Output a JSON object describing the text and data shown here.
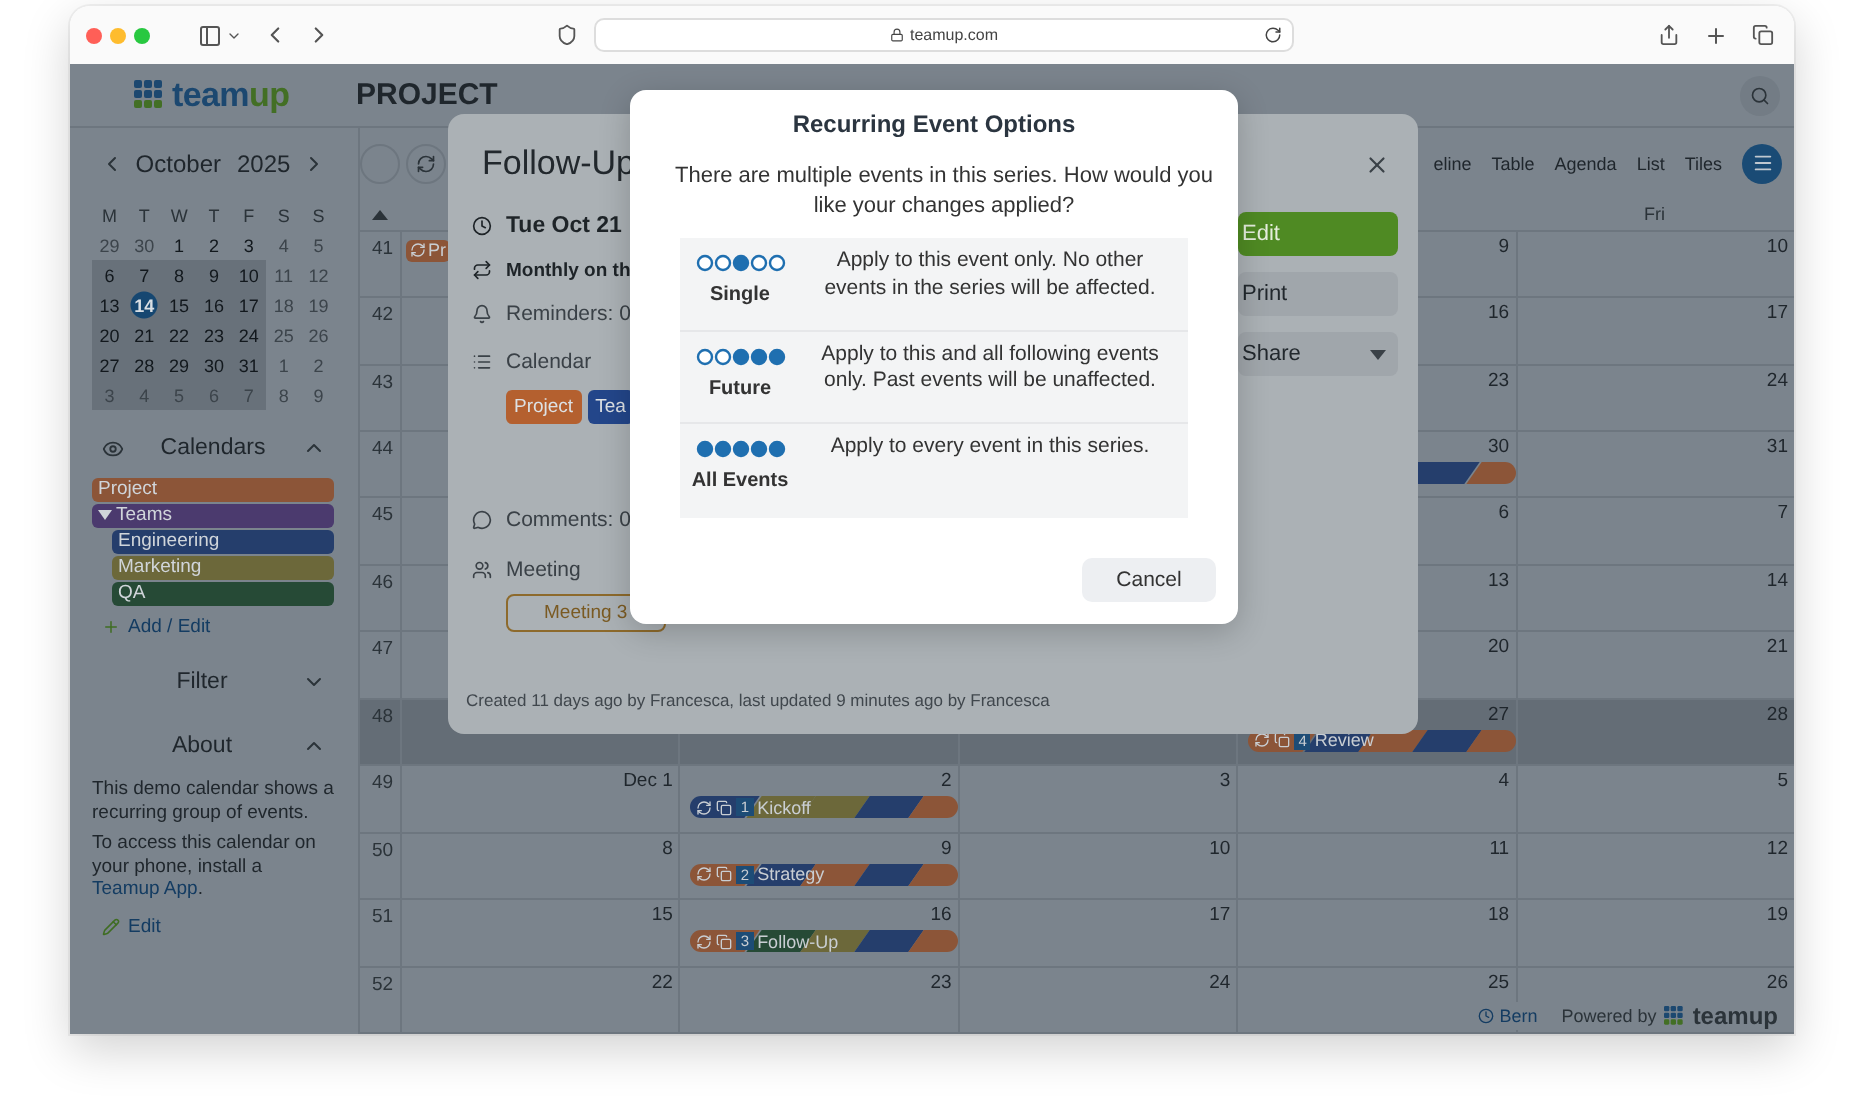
{
  "browser": {
    "address": "teamup.com"
  },
  "app_header": {
    "logo": [
      "team",
      "up"
    ],
    "title": "PROJECT"
  },
  "mini_calendar": {
    "month": "October",
    "year": "2025",
    "weekdays": [
      "M",
      "T",
      "W",
      "T",
      "F",
      "S",
      "S"
    ],
    "weeks": [
      {
        "in_view": false,
        "days": [
          {
            "label": "29",
            "muted": true,
            "today": false
          },
          {
            "label": "30",
            "muted": true,
            "today": false
          },
          {
            "label": "1",
            "muted": false,
            "today": false
          },
          {
            "label": "2",
            "muted": false,
            "today": false
          },
          {
            "label": "3",
            "muted": false,
            "today": false
          },
          {
            "label": "4",
            "muted": true,
            "today": false
          },
          {
            "label": "5",
            "muted": true,
            "today": false
          }
        ]
      },
      {
        "in_view": true,
        "days": [
          {
            "label": "6",
            "muted": false,
            "today": false
          },
          {
            "label": "7",
            "muted": false,
            "today": false
          },
          {
            "label": "8",
            "muted": false,
            "today": false
          },
          {
            "label": "9",
            "muted": false,
            "today": false
          },
          {
            "label": "10",
            "muted": false,
            "today": false
          },
          {
            "label": "11",
            "muted": true,
            "today": false
          },
          {
            "label": "12",
            "muted": true,
            "today": false
          }
        ]
      },
      {
        "in_view": true,
        "days": [
          {
            "label": "13",
            "muted": false,
            "today": false
          },
          {
            "label": "14",
            "muted": false,
            "today": true
          },
          {
            "label": "15",
            "muted": false,
            "today": false
          },
          {
            "label": "16",
            "muted": false,
            "today": false
          },
          {
            "label": "17",
            "muted": false,
            "today": false
          },
          {
            "label": "18",
            "muted": true,
            "today": false
          },
          {
            "label": "19",
            "muted": true,
            "today": false
          }
        ]
      },
      {
        "in_view": true,
        "days": [
          {
            "label": "20",
            "muted": false,
            "today": false
          },
          {
            "label": "21",
            "muted": false,
            "today": false
          },
          {
            "label": "22",
            "muted": false,
            "today": false
          },
          {
            "label": "23",
            "muted": false,
            "today": false
          },
          {
            "label": "24",
            "muted": false,
            "today": false
          },
          {
            "label": "25",
            "muted": true,
            "today": false
          },
          {
            "label": "26",
            "muted": true,
            "today": false
          }
        ]
      },
      {
        "in_view": true,
        "days": [
          {
            "label": "27",
            "muted": false,
            "today": false
          },
          {
            "label": "28",
            "muted": false,
            "today": false
          },
          {
            "label": "29",
            "muted": false,
            "today": false
          },
          {
            "label": "30",
            "muted": false,
            "today": false
          },
          {
            "label": "31",
            "muted": false,
            "today": false
          },
          {
            "label": "1",
            "muted": true,
            "today": false
          },
          {
            "label": "2",
            "muted": true,
            "today": false
          }
        ]
      },
      {
        "in_view": true,
        "days": [
          {
            "label": "3",
            "muted": true,
            "today": false
          },
          {
            "label": "4",
            "muted": true,
            "today": false
          },
          {
            "label": "5",
            "muted": true,
            "today": false
          },
          {
            "label": "6",
            "muted": true,
            "today": false
          },
          {
            "label": "7",
            "muted": true,
            "today": false
          },
          {
            "label": "8",
            "muted": true,
            "today": false
          },
          {
            "label": "9",
            "muted": true,
            "today": false
          }
        ]
      }
    ]
  },
  "calendars": {
    "title": "Calendars",
    "expanded": true,
    "items": [
      {
        "name": "Project",
        "color": "#8c5538"
      },
      {
        "name": "Teams",
        "color": "#4b3a6e",
        "expanded": true,
        "children": [
          {
            "name": "Engineering",
            "color": "#253e6c"
          },
          {
            "name": "Marketing",
            "color": "#6c683a"
          },
          {
            "name": "QA",
            "color": "#264a36"
          }
        ]
      }
    ],
    "add_edit": "Add / Edit"
  },
  "filter": {
    "title": "Filter",
    "expanded": false
  },
  "about": {
    "title": "About",
    "expanded": true,
    "paragraphs": [
      {
        "text": "This demo calendar shows a recurring group of events."
      },
      {
        "text": "To access this calendar on your phone, install a",
        "link": "Teamup App",
        "after": "."
      }
    ],
    "edit": "Edit"
  },
  "toolbar": {
    "views": [
      "eline",
      "Table",
      "Agenda",
      "List",
      "Tiles"
    ]
  },
  "grid": {
    "header": {
      "fri": "Fri"
    },
    "rows": [
      {
        "week": "41",
        "highlighted": false,
        "days": {
          "mon": {
            "events": [
              {
                "kind": "chip",
                "title": "Pr",
                "color": "#8c5538"
              }
            ]
          },
          "thu": {
            "date": "9"
          },
          "fri": {
            "date": "10"
          }
        }
      },
      {
        "week": "42",
        "highlighted": false,
        "days": {
          "thu": {
            "date": "16"
          },
          "fri": {
            "date": "17"
          }
        }
      },
      {
        "week": "43",
        "highlighted": false,
        "days": {
          "thu": {
            "date": "23"
          },
          "fri": {
            "date": "24"
          }
        }
      },
      {
        "week": "44",
        "highlighted": false,
        "days": {
          "thu": {
            "date": "30",
            "events": [
              {
                "kind": "bar",
                "stripes": [
                  {
                    "color": "#253e6c"
                  },
                  {
                    "color": "#8c5538"
                  }
                ]
              }
            ]
          },
          "fri": {
            "date": "31"
          }
        }
      },
      {
        "week": "45",
        "highlighted": false,
        "days": {
          "thu": {
            "date": "6"
          },
          "fri": {
            "date": "7"
          }
        }
      },
      {
        "week": "46",
        "highlighted": false,
        "days": {
          "thu": {
            "date": "13"
          },
          "fri": {
            "date": "14"
          }
        }
      },
      {
        "week": "47",
        "highlighted": false,
        "days": {
          "thu": {
            "date": "20"
          },
          "fri": {
            "date": "21"
          }
        }
      },
      {
        "week": "48",
        "highlighted": true,
        "days": {
          "thu": {
            "date": "27",
            "events": [
              {
                "kind": "bar",
                "number": "4",
                "title": "Review",
                "stripes": [
                  {
                    "color": "#8c5538"
                  },
                  {
                    "color": "#253e6c"
                  },
                  {
                    "color": "#8c5538"
                  },
                  {
                    "color": "#253e6c"
                  },
                  {
                    "color": "#8c5538"
                  }
                ]
              }
            ]
          },
          "fri": {
            "date": "28"
          }
        }
      },
      {
        "week": "49",
        "highlighted": false,
        "days": {
          "mon": {
            "date": "Dec 1"
          },
          "tue": {
            "date": "2",
            "events": [
              {
                "kind": "bar",
                "number": "1",
                "title": "Kickoff",
                "stripes": [
                  {
                    "color": "#253e6c"
                  },
                  {
                    "color": "#6c683a"
                  },
                  {
                    "color": "#6c683a"
                  },
                  {
                    "color": "#253e6c"
                  },
                  {
                    "color": "#8c5538"
                  }
                ]
              }
            ]
          },
          "wed": {
            "date": "3"
          },
          "thu": {
            "date": "4"
          },
          "fri": {
            "date": "5"
          }
        }
      },
      {
        "week": "50",
        "highlighted": false,
        "days": {
          "mon": {
            "date": "8"
          },
          "tue": {
            "date": "9",
            "events": [
              {
                "kind": "bar",
                "number": "2",
                "title": "Strategy",
                "stripes": [
                  {
                    "color": "#8c5538"
                  },
                  {
                    "color": "#253e6c"
                  },
                  {
                    "color": "#8c5538"
                  },
                  {
                    "color": "#253e6c"
                  },
                  {
                    "color": "#8c5538"
                  }
                ]
              }
            ]
          },
          "wed": {
            "date": "10"
          },
          "thu": {
            "date": "11"
          },
          "fri": {
            "date": "12"
          }
        }
      },
      {
        "week": "51",
        "highlighted": false,
        "days": {
          "mon": {
            "date": "15"
          },
          "tue": {
            "date": "16",
            "events": [
              {
                "kind": "bar",
                "number": "3",
                "title": "Follow-Up",
                "stripes": [
                  {
                    "color": "#8c5538"
                  },
                  {
                    "color": "#264a36"
                  },
                  {
                    "color": "#6c683a"
                  },
                  {
                    "color": "#253e6c"
                  },
                  {
                    "color": "#8c5538"
                  }
                ]
              }
            ]
          },
          "wed": {
            "date": "17"
          },
          "thu": {
            "date": "18"
          },
          "fri": {
            "date": "19"
          }
        }
      },
      {
        "week": "52",
        "highlighted": false,
        "days": {
          "mon": {
            "date": "22"
          },
          "tue": {
            "date": "23"
          },
          "wed": {
            "date": "24"
          },
          "thu": {
            "date": "25"
          },
          "fri": {
            "date": "26"
          }
        }
      }
    ]
  },
  "footer": {
    "timezone": "Bern",
    "powered_by": "Powered by",
    "brand": "teamup"
  },
  "event_dialog": {
    "title": "Follow-Up",
    "date": "Tue Oct 21",
    "recurrence": "Monthly on th",
    "reminders": "Reminders: 0",
    "calendar_label": "Calendar",
    "calendars": [
      {
        "name": "Project",
        "color": "#b4602f"
      },
      {
        "name": "Tea",
        "color": "#23468a"
      }
    ],
    "comments": "Comments: 0",
    "meeting_label": "Meeting",
    "meeting_chip": "Meeting 3",
    "created": "Created 11 days ago by Francesca, last updated 9 minutes ago by Francesca",
    "actions": [
      {
        "kind": "primary",
        "label": "Edit"
      },
      {
        "kind": "plain",
        "label": "Print"
      },
      {
        "kind": "dropdown",
        "label": "Share"
      }
    ]
  },
  "recurring_dialog": {
    "title": "Recurring Event Options",
    "message": "There are multiple events in this series. How would you like your changes applied?",
    "options": [
      {
        "kind": "single",
        "label": "Single",
        "description": "Apply to this event only. No other events in the series will be affected."
      },
      {
        "kind": "future",
        "label": "Future",
        "description": "Apply to this and all following events only. Past events will be unaffected."
      },
      {
        "kind": "all",
        "label": "All Events",
        "description": "Apply to every event in this series."
      }
    ],
    "cancel": "Cancel"
  }
}
